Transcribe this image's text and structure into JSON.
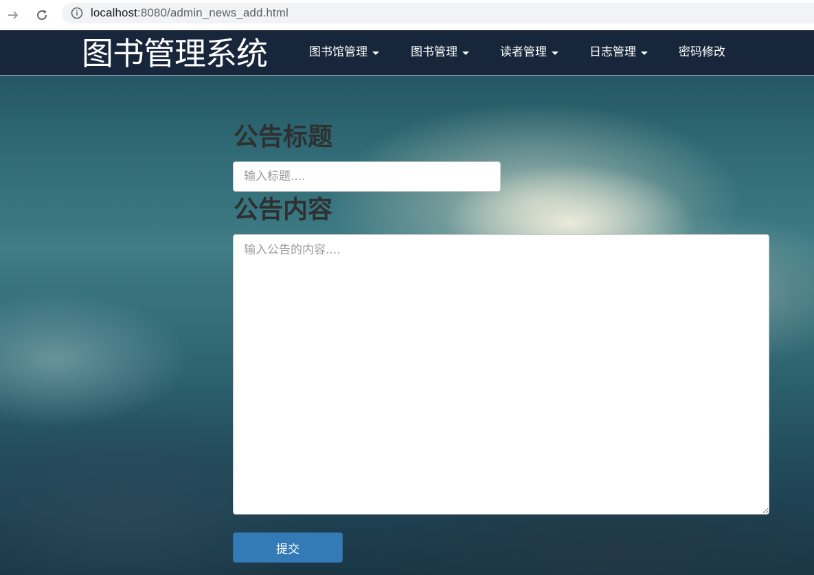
{
  "browser": {
    "url_host": "localhost",
    "url_rest": ":8080/admin_news_add.html"
  },
  "navbar": {
    "brand": "图书管理系统",
    "menu": [
      {
        "label": "图书馆管理",
        "dropdown": true
      },
      {
        "label": "图书管理",
        "dropdown": true
      },
      {
        "label": "读者管理",
        "dropdown": true
      },
      {
        "label": "日志管理",
        "dropdown": true
      },
      {
        "label": "密码修改",
        "dropdown": false
      }
    ]
  },
  "form": {
    "title_label": "公告标题",
    "title_placeholder": "输入标题....",
    "content_label": "公告内容",
    "content_placeholder": "输入公告的内容....",
    "submit_label": "提交"
  },
  "colors": {
    "navbar_bg": "#17263b",
    "primary_button": "#337ab7"
  }
}
